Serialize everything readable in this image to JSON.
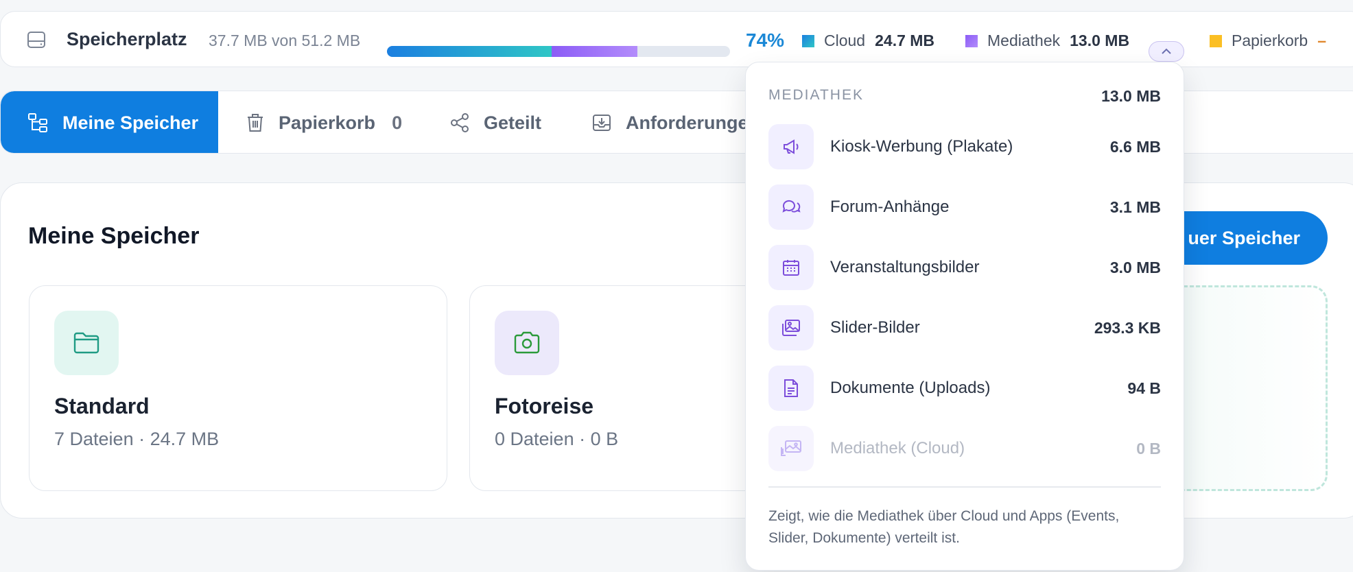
{
  "topbar": {
    "title": "Speicherplatz",
    "usage": "37.7 MB von 51.2 MB",
    "percent_label": "74%",
    "percent": 74,
    "cloud_fraction": 0.48,
    "media_fraction": 0.25,
    "legend": {
      "cloud_label": "Cloud",
      "cloud_value": "24.7 MB",
      "cloud_color": "#1b8fd8",
      "media_label": "Mediathek",
      "media_value": "13.0 MB",
      "media_color": "#8b5cf6",
      "trash_label": "Papierkorb",
      "trash_value": "–",
      "trash_color": "#fbbf24"
    }
  },
  "tabs": {
    "mine": "Meine Speicher",
    "trash": "Papierkorb",
    "trash_count": "0",
    "shared": "Geteilt",
    "requests": "Anforderunge"
  },
  "main": {
    "title": "Meine Speicher",
    "new_button": "uer Speicher",
    "peek_text": "r",
    "cards": [
      {
        "name": "Standard",
        "meta": "7 Dateien · 24.7 MB",
        "icon": "folder-icon"
      },
      {
        "name": "Fotoreise",
        "meta": "0 Dateien · 0 B",
        "icon": "camera-icon"
      }
    ]
  },
  "dropdown": {
    "heading": "MEDIATHEK",
    "total": "13.0 MB",
    "rows": [
      {
        "label": "Kiosk-Werbung (Plakate)",
        "value": "6.6 MB",
        "icon": "megaphone-icon"
      },
      {
        "label": "Forum-Anhänge",
        "value": "3.1 MB",
        "icon": "chat-icon"
      },
      {
        "label": "Veranstaltungsbilder",
        "value": "3.0 MB",
        "icon": "calendar-icon"
      },
      {
        "label": "Slider-Bilder",
        "value": "293.3 KB",
        "icon": "images-icon"
      },
      {
        "label": "Dokumente (Uploads)",
        "value": "94 B",
        "icon": "document-icon"
      },
      {
        "label": "Mediathek (Cloud)",
        "value": "0 B",
        "icon": "cloud-gallery-icon"
      }
    ],
    "footer": "Zeigt, wie die Mediathek über Cloud und Apps (Events, Slider, Dokumente) verteilt ist."
  }
}
